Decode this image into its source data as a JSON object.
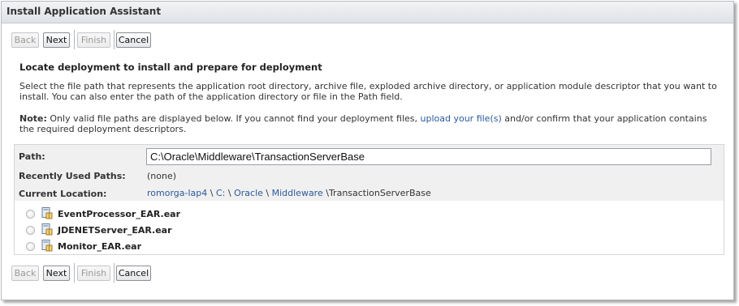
{
  "window": {
    "title": "Install Application Assistant"
  },
  "buttons": {
    "back": "Back",
    "next": "Next",
    "finish": "Finish",
    "cancel": "Cancel"
  },
  "section": {
    "heading": "Locate deployment to install and prepare for deployment",
    "description": "Select the file path that represents the application root directory, archive file, exploded archive directory, or application module descriptor that you want to install. You can also enter the path of the application directory or file in the Path field.",
    "note_label": "Note:",
    "note_before": "Only valid file paths are displayed below. If you cannot find your deployment files,",
    "note_link": "upload your file(s)",
    "note_after": "and/or confirm that your application contains the required deployment descriptors."
  },
  "path_field": {
    "label": "Path:",
    "value": "C:\\Oracle\\Middleware\\TransactionServerBase"
  },
  "recent_paths": {
    "label": "Recently Used Paths:",
    "value": "(none)"
  },
  "current_location": {
    "label": "Current Location:",
    "crumbs": [
      "romorga-lap4",
      "C:",
      "Oracle",
      "Middleware"
    ],
    "current": "TransactionServerBase",
    "separator": "\\"
  },
  "files": [
    {
      "name": "EventProcessor_EAR.ear",
      "icon": "archive-file-icon"
    },
    {
      "name": "JDENETServer_EAR.ear",
      "icon": "archive-file-icon"
    },
    {
      "name": "Monitor_EAR.ear",
      "icon": "archive-file-icon"
    }
  ]
}
